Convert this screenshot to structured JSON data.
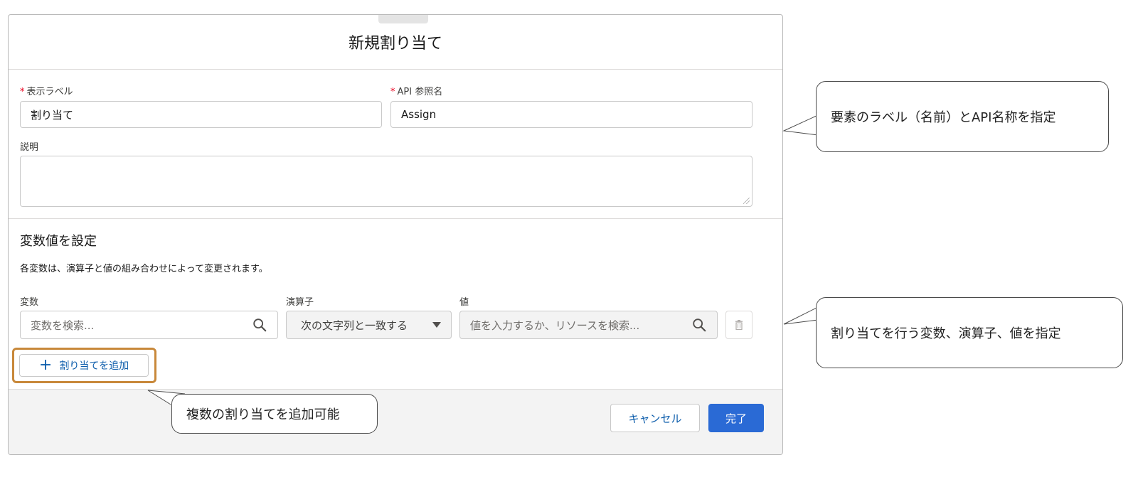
{
  "modal": {
    "title": "新規割り当て",
    "label_field": {
      "label": "表示ラベル",
      "required_mark": "*",
      "value": "割り当て"
    },
    "api_field": {
      "label": "API 参照名",
      "required_mark": "*",
      "value": "Assign"
    },
    "description_field": {
      "label": "説明",
      "value": ""
    }
  },
  "assignment_section": {
    "title": "変数値を設定",
    "description": "各変数は、演算子と値の組み合わせによって変更されます。",
    "columns": {
      "variable": "変数",
      "operator": "演算子",
      "value": "値"
    },
    "variable_search": {
      "placeholder": "変数を検索..."
    },
    "operator_select": {
      "value": "次の文字列と一致する"
    },
    "value_search": {
      "placeholder": "値を入力するか、リソースを検索..."
    },
    "add_button": {
      "icon": "plus-icon",
      "label": "割り当てを追加"
    }
  },
  "footer": {
    "cancel_label": "キャンセル",
    "done_label": "完了"
  },
  "callouts": {
    "label_callout": "要素のラベル（名前）とAPI名称を指定",
    "assignment_callout": "割り当てを行う変数、演算子、値を指定",
    "add_callout": "複数の割り当てを追加可能"
  },
  "colors": {
    "primary": "#2a6ad5",
    "link": "#0b5cab",
    "required": "#ea001e",
    "highlight_border": "#c8883a"
  }
}
